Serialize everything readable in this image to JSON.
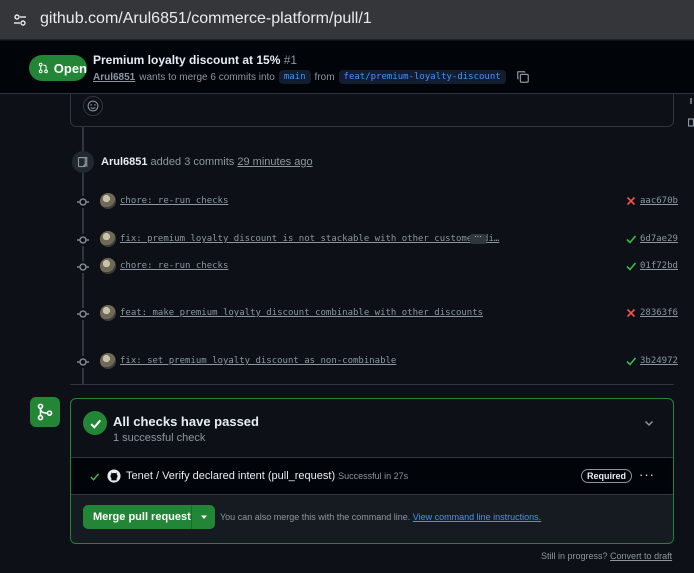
{
  "browser": {
    "url_host": "github.com",
    "url_path": "/Arul6851/commerce-platform/pull/1"
  },
  "pr": {
    "state": "Open",
    "title": "Premium loyalty discount at 15%",
    "number": "#1",
    "author": "Arul6851",
    "merge_text": "wants to merge 6 commits into",
    "base_branch": "main",
    "from_text": "from",
    "head_branch": "feat/premium-loyalty-discount"
  },
  "timeline": {
    "event_author": "Arul6851",
    "event_text": "added 3 commits",
    "event_time": "29 minutes ago",
    "commits": [
      {
        "message": "chore: re-run checks",
        "sha": "aac670b",
        "status": "failure"
      },
      {
        "message": "fix: premium loyalty discount is not stackable with other customer di…",
        "sha": "6d7ae29",
        "status": "success"
      },
      {
        "message": "chore: re-run checks",
        "sha": "01f72bd",
        "status": "success"
      },
      {
        "message": "feat: make premium loyalty discount combinable with other discounts",
        "sha": "28363f6",
        "status": "failure"
      },
      {
        "message": "fix: set premium loyalty discount as non-combinable",
        "sha": "3b24972",
        "status": "success"
      }
    ]
  },
  "checks": {
    "title": "All checks have passed",
    "subtitle": "1 successful check",
    "items": [
      {
        "name": "Tenet / Verify declared intent (pull_request)",
        "duration": "Successful in 27s",
        "badge": "Required"
      }
    ]
  },
  "merge": {
    "button_label": "Merge pull request",
    "hint": "You can also merge this with the command line.",
    "hint_link": "View command line instructions."
  },
  "footer": {
    "progress_text": "Still in progress?",
    "draft_link": "Convert to draft"
  },
  "colors": {
    "success": "#3fb950",
    "failure": "#f85149",
    "accent": "#238636",
    "link": "#4493f8"
  }
}
